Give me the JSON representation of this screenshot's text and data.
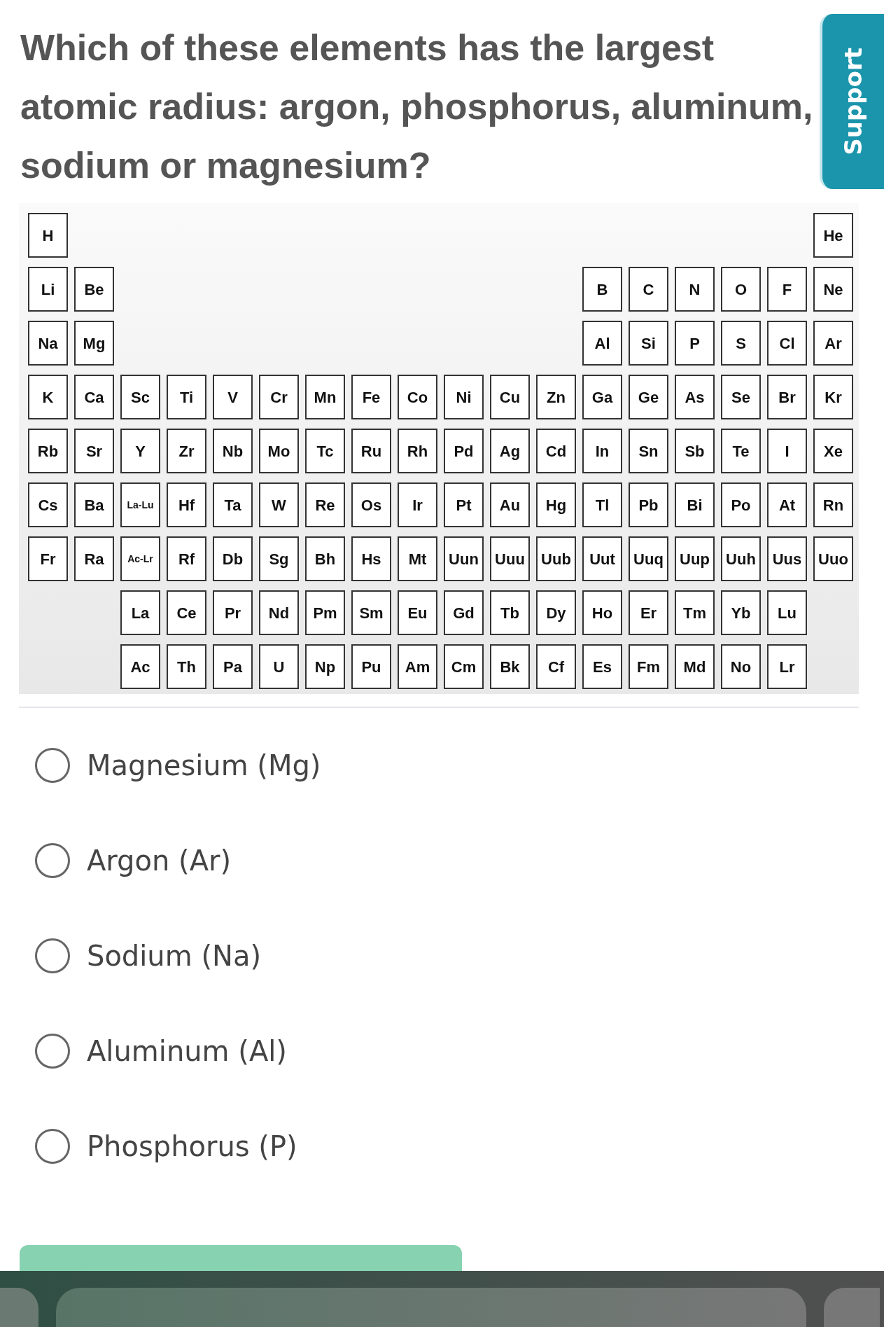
{
  "question": "Which of these elements has the largest atomic radius: argon, phosphorus, aluminum, sodium or magnesium?",
  "support_tab": {
    "label": "Support"
  },
  "periodic_table": {
    "rows": [
      [
        "H",
        "",
        "",
        "",
        "",
        "",
        "",
        "",
        "",
        "",
        "",
        "",
        "",
        "",
        "",
        "",
        "",
        "He"
      ],
      [
        "Li",
        "Be",
        "",
        "",
        "",
        "",
        "",
        "",
        "",
        "",
        "",
        "",
        "B",
        "C",
        "N",
        "O",
        "F",
        "Ne"
      ],
      [
        "Na",
        "Mg",
        "",
        "",
        "",
        "",
        "",
        "",
        "",
        "",
        "",
        "",
        "Al",
        "Si",
        "P",
        "S",
        "Cl",
        "Ar"
      ],
      [
        "K",
        "Ca",
        "Sc",
        "Ti",
        "V",
        "Cr",
        "Mn",
        "Fe",
        "Co",
        "Ni",
        "Cu",
        "Zn",
        "Ga",
        "Ge",
        "As",
        "Se",
        "Br",
        "Kr"
      ],
      [
        "Rb",
        "Sr",
        "Y",
        "Zr",
        "Nb",
        "Mo",
        "Tc",
        "Ru",
        "Rh",
        "Pd",
        "Ag",
        "Cd",
        "In",
        "Sn",
        "Sb",
        "Te",
        "I",
        "Xe"
      ],
      [
        "Cs",
        "Ba",
        "La-Lu",
        "Hf",
        "Ta",
        "W",
        "Re",
        "Os",
        "Ir",
        "Pt",
        "Au",
        "Hg",
        "Tl",
        "Pb",
        "Bi",
        "Po",
        "At",
        "Rn"
      ],
      [
        "Fr",
        "Ra",
        "Ac-Lr",
        "Rf",
        "Db",
        "Sg",
        "Bh",
        "Hs",
        "Mt",
        "Uun",
        "Uuu",
        "Uub",
        "Uut",
        "Uuq",
        "Uup",
        "Uuh",
        "Uus",
        "Uuo"
      ],
      [
        "",
        "",
        "La",
        "Ce",
        "Pr",
        "Nd",
        "Pm",
        "Sm",
        "Eu",
        "Gd",
        "Tb",
        "Dy",
        "Ho",
        "Er",
        "Tm",
        "Yb",
        "Lu"
      ],
      [
        "",
        "",
        "Ac",
        "Th",
        "Pa",
        "U",
        "Np",
        "Pu",
        "Am",
        "Cm",
        "Bk",
        "Cf",
        "Es",
        "Fm",
        "Md",
        "No",
        "Lr"
      ]
    ]
  },
  "options": [
    {
      "label": "Magnesium (Mg)",
      "selected": false
    },
    {
      "label": "Argon (Ar)",
      "selected": false
    },
    {
      "label": "Sodium (Na)",
      "selected": false
    },
    {
      "label": "Aluminum (Al)",
      "selected": false
    },
    {
      "label": "Phosphorus (P)",
      "selected": false
    }
  ]
}
